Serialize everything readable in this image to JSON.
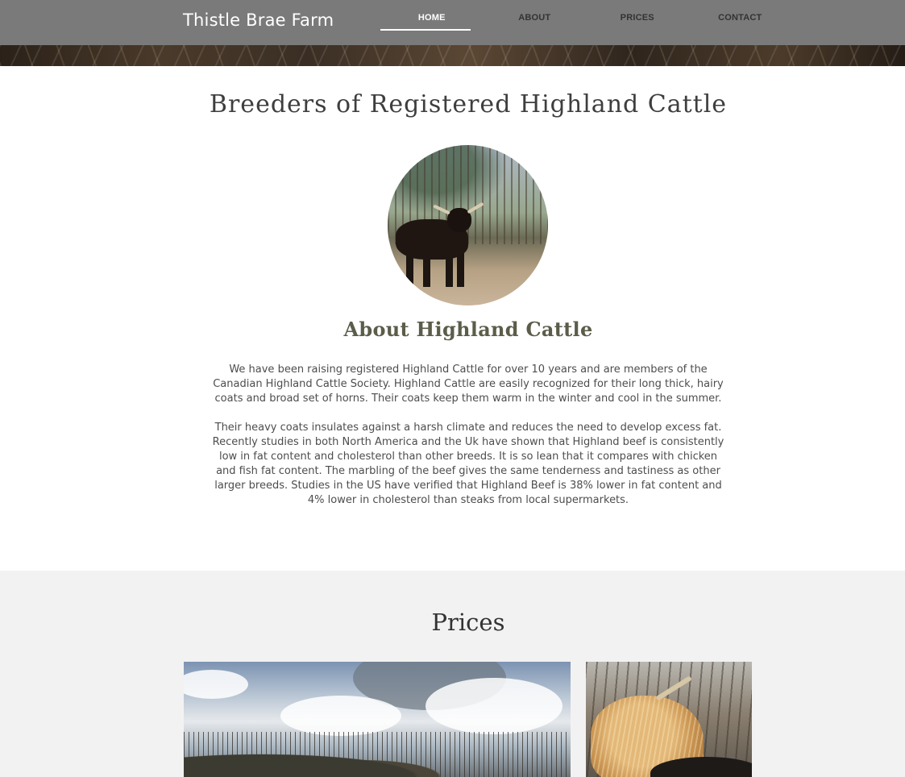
{
  "header": {
    "site_title": "Thistle Brae Farm",
    "nav": [
      {
        "label": "HOME",
        "active": true
      },
      {
        "label": "ABOUT",
        "active": false
      },
      {
        "label": "PRICES",
        "active": false
      },
      {
        "label": "CONTACT",
        "active": false
      }
    ]
  },
  "about": {
    "main_heading": "Breeders of Registered Highland Cattle",
    "heading": "About Highland Cattle",
    "paragraph_1": "We have been raising registered Highland Cattle for over 10 years and are members of the Canadian Highland Cattle Society. Highland Cattle are easily recognized for their long thick, hairy coats and broad set of horns. Their coats keep them warm in the winter and cool in the summer.",
    "paragraph_2": "Their heavy coats insulates against a harsh climate and reduces the need to develop excess fat. Recently studies in both North America and the Uk have shown that Highland beef is consistently low in fat content and cholesterol than other breeds. It is so lean that it compares with chicken and fish fat content. The marbling of the beef gives the same tenderness and tastiness as other larger breeds. Studies in the US have verified that Highland Beef is 38% lower in fat content and 4% lower in cholesterol than steaks from local supermarkets."
  },
  "prices": {
    "heading": "Prices"
  },
  "colors": {
    "header_bg": "#7a7a7a",
    "prices_bg": "#f2f2f2",
    "heading_text": "#5c5c4a"
  }
}
